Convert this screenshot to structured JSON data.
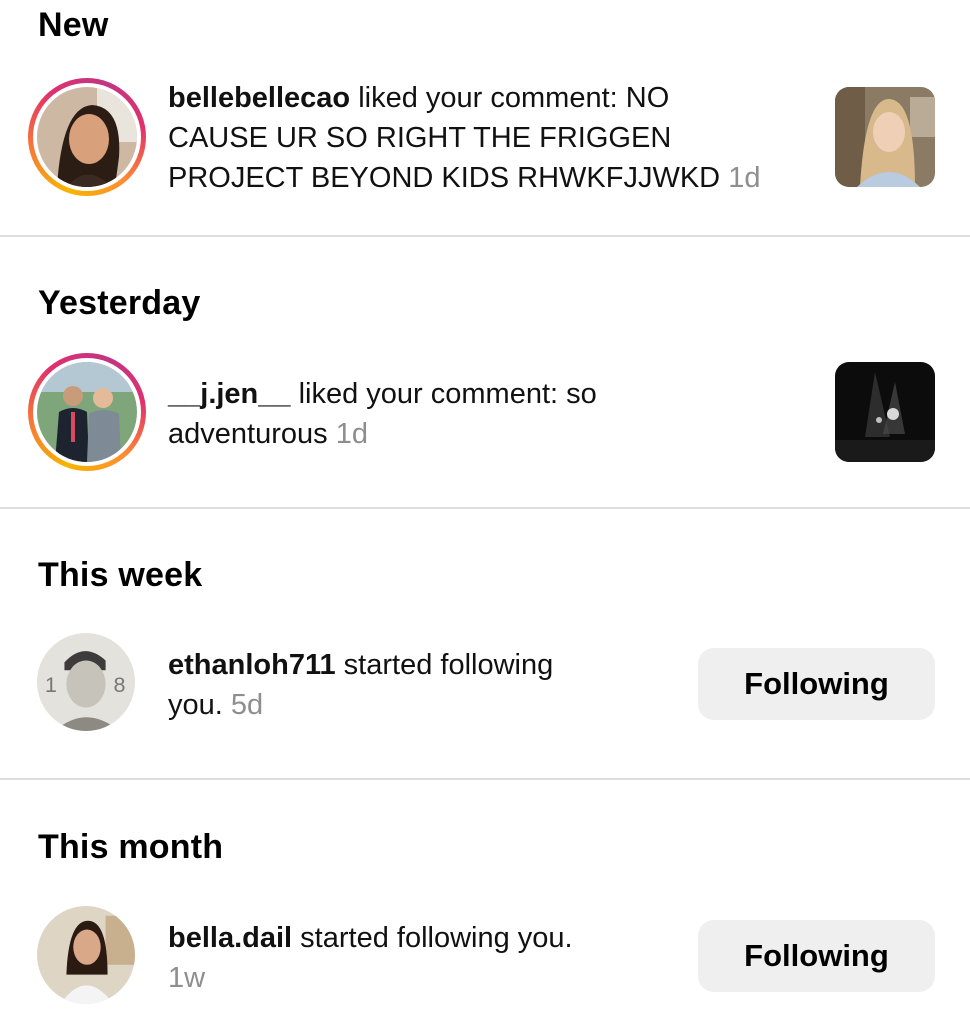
{
  "sections": [
    {
      "title": "New",
      "notification": {
        "username": "bellebellecao",
        "action_line1": " liked your comment: NO",
        "line2": "CAUSE UR SO RIGHT THE FRIGGEN",
        "line3": "PROJECT BEYOND KIDS RHWKFJJWKD",
        "time": "1d"
      }
    },
    {
      "title": "Yesterday",
      "notification": {
        "username": "__j.jen__",
        "action_line1": " liked your comment: so",
        "line2": "adventurous",
        "time": "1d"
      }
    },
    {
      "title": "This week",
      "notification": {
        "username": "ethanloh711",
        "action_line1": " started following",
        "line2": "you.",
        "time": "5d",
        "button_label": "Following"
      }
    },
    {
      "title": "This month",
      "notification": {
        "username": "bella.dail",
        "action_line1": " started following you.",
        "time": "1w",
        "button_label": "Following"
      }
    }
  ],
  "colors": {
    "story_ring": [
      "#f7b500",
      "#e1306c",
      "#c13584"
    ],
    "timestamp": "#8e8e8e",
    "button_bg": "#efefef",
    "divider": "#dedede"
  }
}
